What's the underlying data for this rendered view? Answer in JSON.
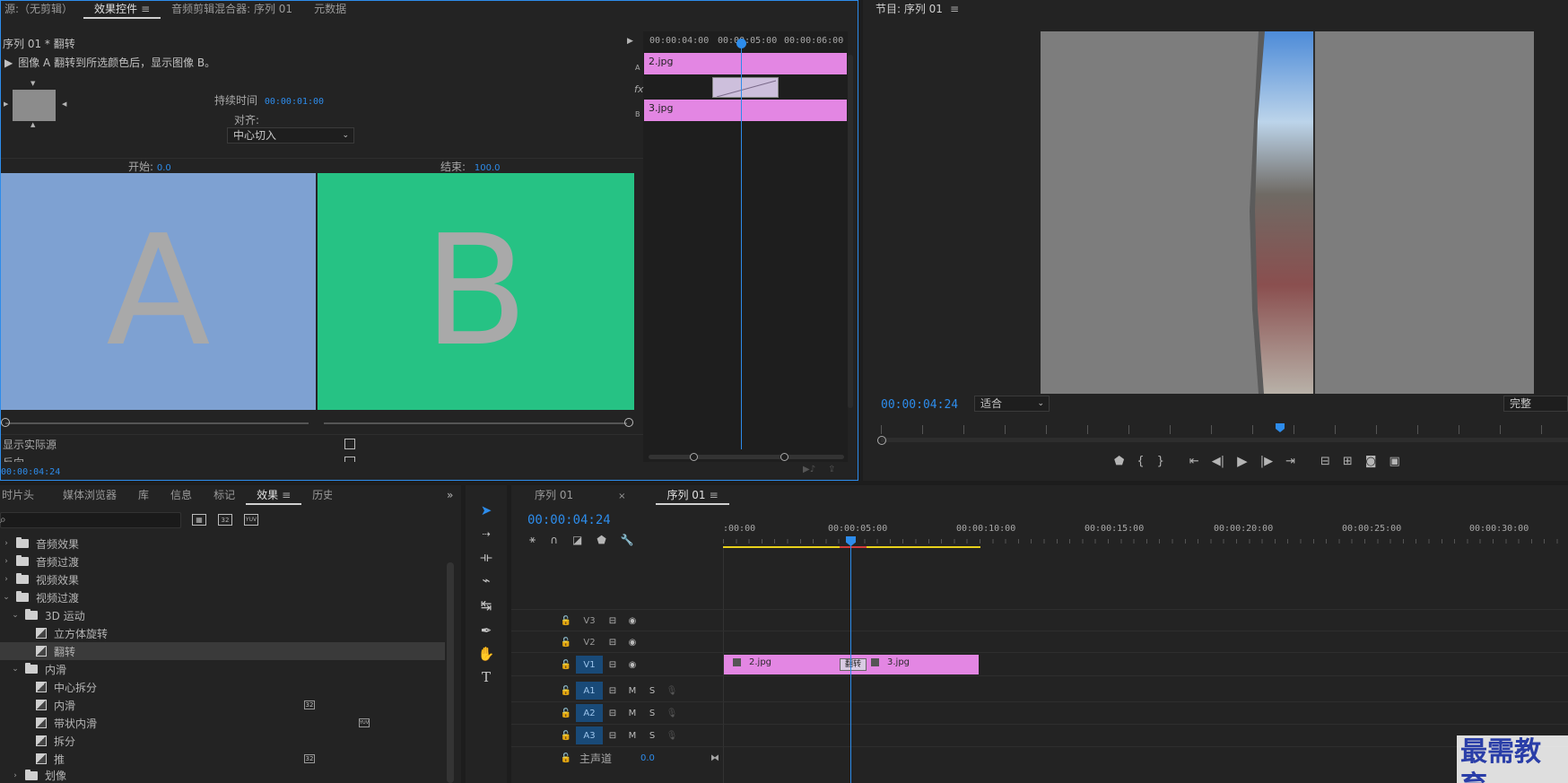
{
  "effect_controls": {
    "tabs": [
      {
        "label": "源:（无剪辑）"
      },
      {
        "label": "效果控件",
        "active": true
      },
      {
        "label": "音频剪辑混合器: 序列 01"
      },
      {
        "label": "元数据"
      }
    ],
    "breadcrumb": "序列 01 * 翻转",
    "description": "图像 A 翻转到所选颜色后，显示图像 B。",
    "duration_label": "持续时间",
    "duration_value": "00:00:01:00",
    "align_label": "对齐:",
    "align_value": "中心切入",
    "start_label": "开始:",
    "start_value": "0.0",
    "end_label": "结束:",
    "end_value": "100.0",
    "preview_a_letter": "A",
    "preview_b_letter": "B",
    "show_actual_source": "显示实际源",
    "reverse": "反向",
    "timecode": "00:00:04:24",
    "mini_ruler": [
      "00:00:04:00",
      "00:00:05:00",
      "00:00:06:00"
    ],
    "track_a": "A",
    "track_b": "B",
    "clip_a": "2.jpg",
    "clip_b": "3.jpg",
    "fx_label": "fx"
  },
  "program_monitor": {
    "title": "节目: 序列 01",
    "timecode": "00:00:04:24",
    "fit": "适合",
    "quality": "完整"
  },
  "project_panel": {
    "tabs": [
      {
        "label": "时片头"
      },
      {
        "label": "媒体浏览器"
      },
      {
        "label": "库"
      },
      {
        "label": "信息"
      },
      {
        "label": "标记"
      },
      {
        "label": "效果",
        "active": true
      },
      {
        "label": "历史"
      }
    ],
    "search_placeholder": "",
    "tree": [
      {
        "label": "音频效果",
        "type": "folder",
        "level": 0,
        "expanded": false
      },
      {
        "label": "音频过渡",
        "type": "folder",
        "level": 0,
        "expanded": false
      },
      {
        "label": "视频效果",
        "type": "folder",
        "level": 0,
        "expanded": false
      },
      {
        "label": "视频过渡",
        "type": "folder",
        "level": 0,
        "expanded": true
      },
      {
        "label": "3D 运动",
        "type": "folder",
        "level": 1,
        "expanded": true
      },
      {
        "label": "立方体旋转",
        "type": "effect",
        "level": 2
      },
      {
        "label": "翻转",
        "type": "effect",
        "level": 2,
        "selected": true
      },
      {
        "label": "内滑",
        "type": "folder",
        "level": 1,
        "expanded": true
      },
      {
        "label": "中心拆分",
        "type": "effect",
        "level": 2
      },
      {
        "label": "内滑",
        "type": "effect",
        "level": 2,
        "badge": "32"
      },
      {
        "label": "带状内滑",
        "type": "effect",
        "level": 2,
        "badge": "YUV"
      },
      {
        "label": "拆分",
        "type": "effect",
        "level": 2
      },
      {
        "label": "推",
        "type": "effect",
        "level": 2,
        "badge": "32"
      },
      {
        "label": "划像",
        "type": "folder",
        "level": 1,
        "expanded": false
      }
    ]
  },
  "timeline": {
    "tabs": [
      {
        "label": "序列 01"
      },
      {
        "label": "序列 01",
        "active": true
      }
    ],
    "timecode": "00:00:04:24",
    "ruler": [
      ":00:00",
      "00:00:05:00",
      "00:00:10:00",
      "00:00:15:00",
      "00:00:20:00",
      "00:00:25:00",
      "00:00:30:00"
    ],
    "video_tracks": [
      "V3",
      "V2",
      "V1"
    ],
    "audio_tracks": [
      "A1",
      "A2",
      "A3"
    ],
    "mute": "M",
    "solo": "S",
    "master_label": "主声道",
    "master_value": "0.0",
    "clip1": "2.jpg",
    "clip2": "3.jpg",
    "transition": "翻转"
  },
  "watermark": "最需教育",
  "colors": {
    "accent": "#2d8ceb",
    "clip": "#e386e3",
    "preview_a": "#7ea1d2",
    "preview_b": "#26c284"
  }
}
